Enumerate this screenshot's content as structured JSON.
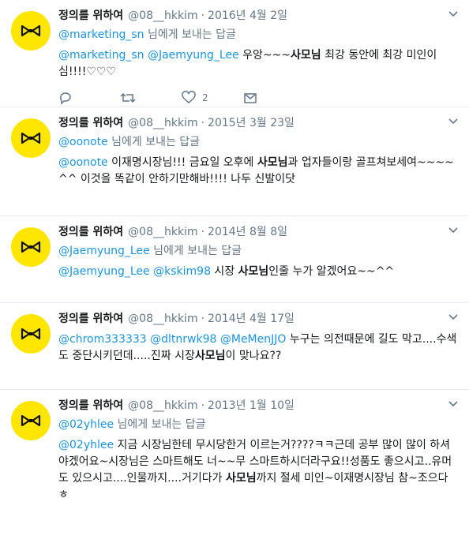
{
  "tweets": [
    {
      "name": "정의를 위하여",
      "handle": "@08__hkkim",
      "dot": "·",
      "date": "2016년 4월 2일",
      "reply_to": {
        "mention": "@marketing_sn",
        "suffix": " 님에게 보내는 답글"
      },
      "text": {
        "m1": "@marketing_sn",
        "m2": "@Jaemyung_Lee",
        "t1": " 우앙~~~",
        "bold": "사모님",
        "t2": "  최강 동안에 최강 미인이심!!!!♡♡♡"
      },
      "likes": "2"
    },
    {
      "name": "정의를 위하여",
      "handle": "@08__hkkim",
      "dot": "·",
      "date": "2015년 3월 23일",
      "reply_to": {
        "mention": "@oonote",
        "suffix": " 님에게 보내는 답글"
      },
      "text": {
        "m1": "@oonote",
        "t1": " 이재명시장님!!!  금요일 오후에 ",
        "bold": "사모님",
        "t2": "과 업자들이랑 골프쳐보세여~~~~^^ 이것을  똑같이 안하기만해바!!!! 나두 신발이닷"
      },
      "likes": ""
    },
    {
      "name": "정의를 위하여",
      "handle": "@08__hkkim",
      "dot": "·",
      "date": "2014년 8월 8일",
      "reply_to": {
        "mention": "@Jaemyung_Lee",
        "suffix": " 님에게 보내는 답글"
      },
      "text": {
        "m1": "@Jaemyung_Lee",
        "m2": "@kskim98",
        "t1": " 시장 ",
        "bold": "사모님",
        "t2": "인줄  누가 알겠어요~~^^"
      },
      "likes": ""
    },
    {
      "name": "정의를 위하여",
      "handle": "@08__hkkim",
      "dot": "·",
      "date": "2014년 4월 17일",
      "text": {
        "m1": "@chrom333333",
        "m2": "@dltnrwk98",
        "m3": "@MeMenJJO",
        "t1": " 누구는 의전때문에  길도 막고....수색도 중단시키던데.....진짜 시장",
        "bold": "사모님",
        "t2": "이 맞나요??"
      },
      "likes": ""
    },
    {
      "name": "정의를 위하여",
      "handle": "@08__hkkim",
      "dot": "·",
      "date": "2013년 1월 10일",
      "reply_to": {
        "mention": "@02yhlee",
        "suffix": " 님에게 보내는 답글"
      },
      "text": {
        "m1": "@02yhlee",
        "t1": " 지금 시장님한테 무시당한거 이르는거????ㅋㅋ근데 공부 많이 많이 하셔야겠어요~시장님은 스마트해도 너~~무 스마트하시더라구요!!성품도 좋으시고..유머도 있으시고....인물까지....거기다가 ",
        "bold": "사모님",
        "t2": "까지 절세 미인~이재명시장님 참~조으다ㅎ"
      },
      "likes": ""
    }
  ],
  "colors": {
    "accent": "#1b95e0",
    "avatar_bg": "#ffe600",
    "muted": "#657786"
  }
}
